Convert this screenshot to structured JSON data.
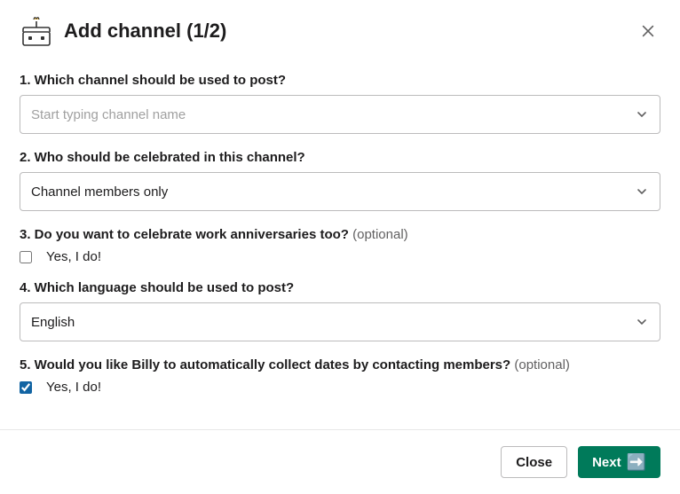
{
  "header": {
    "title": "Add channel (1/2)"
  },
  "fields": {
    "q1": {
      "label": "1. Which channel should be used to post?",
      "placeholder": "Start typing channel name"
    },
    "q2": {
      "label": "2. Who should be celebrated in this channel?",
      "value": "Channel members only"
    },
    "q3": {
      "label": "3. Do you want to celebrate work anniversaries too? ",
      "optional": "(optional)",
      "checkbox_label": "Yes, I do!"
    },
    "q4": {
      "label": "4. Which language should be used to post?",
      "value": "English"
    },
    "q5": {
      "label": "5. Would you like Billy to automatically collect dates by contacting members? ",
      "optional": "(optional)",
      "checkbox_label": "Yes, I do!"
    }
  },
  "footer": {
    "close": "Close",
    "next": "Next"
  }
}
